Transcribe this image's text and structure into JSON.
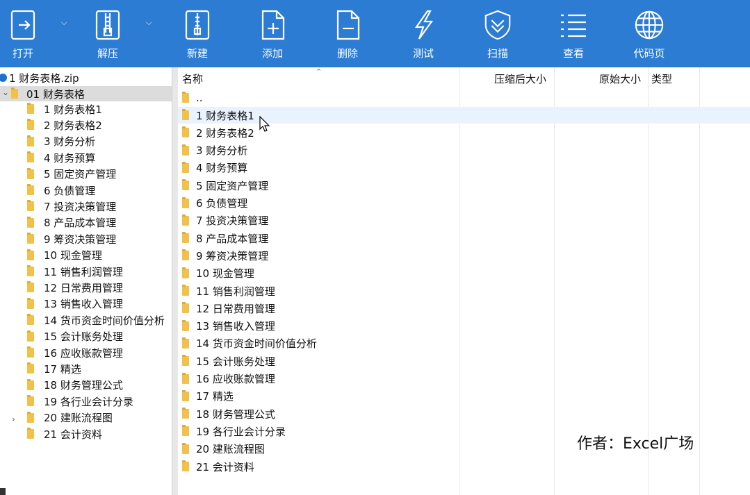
{
  "toolbar": {
    "buttons": [
      {
        "label": "打开",
        "icon": "open-icon"
      },
      {
        "label": "解压",
        "icon": "extract-icon"
      },
      {
        "label": "新建",
        "icon": "new-archive-icon"
      },
      {
        "label": "添加",
        "icon": "add-file-icon"
      },
      {
        "label": "删除",
        "icon": "delete-file-icon"
      },
      {
        "label": "测试",
        "icon": "test-lightning-icon"
      },
      {
        "label": "扫描",
        "icon": "scan-shield-icon"
      },
      {
        "label": "查看",
        "icon": "view-list-icon"
      },
      {
        "label": "代码页",
        "icon": "codepage-globe-icon"
      }
    ],
    "colors": {
      "background": "#2c7cd4",
      "text": "#ffffff"
    }
  },
  "tree": {
    "root": "1 财务表格.zip",
    "selected": "01 财务表格",
    "items": [
      "1 财务表格1",
      "2 财务表格2",
      "3 财务分析",
      "4 财务预算",
      "5 固定资产管理",
      "6 负债管理",
      "7 投资决策管理",
      "8 产品成本管理",
      "9 筹资决策管理",
      "10 现金管理",
      "11 销售利润管理",
      "12 日常费用管理",
      "13 销售收入管理",
      "14 货币资金时间价值分析",
      "15 会计账务处理",
      "16 应收账款管理",
      "17 精选",
      "18 财务管理公式",
      "19 各行业会计分录",
      "20 建账流程图",
      "21 会计资料"
    ]
  },
  "list": {
    "headers": {
      "name": "名称",
      "compressed": "压缩后大小",
      "original": "原始大小",
      "type": "类型"
    },
    "parent": "..",
    "items": [
      "1 财务表格1",
      "2 财务表格2",
      "3 财务分析",
      "4 财务预算",
      "5 固定资产管理",
      "6 负债管理",
      "7 投资决策管理",
      "8 产品成本管理",
      "9 筹资决策管理",
      "10 现金管理",
      "11 销售利润管理",
      "12 日常费用管理",
      "13 销售收入管理",
      "14 货币资金时间价值分析",
      "15 会计账务处理",
      "16 应收账款管理",
      "17 精选",
      "18 财务管理公式",
      "19 各行业会计分录",
      "20 建账流程图",
      "21 会计资料"
    ]
  },
  "watermark": "作者：Excel广场",
  "colors": {
    "folder": "#f2c14a",
    "selection": "#dcdcdc",
    "hover": "#e9f3fd"
  }
}
